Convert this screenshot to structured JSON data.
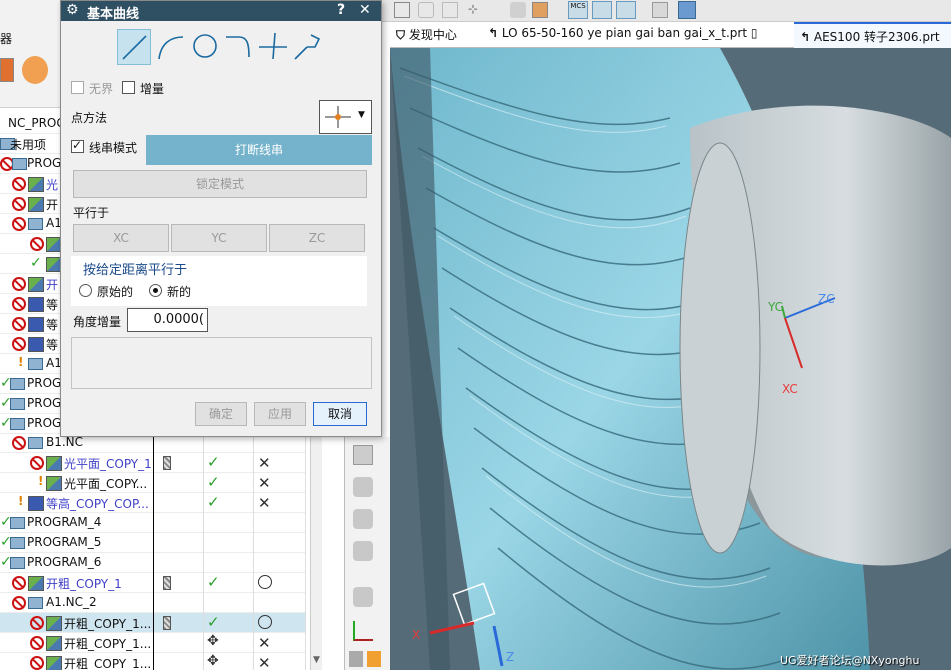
{
  "dialog": {
    "title": "基本曲线",
    "help_glyph": "?",
    "close_glyph": "✕",
    "unbounded_label": "无界",
    "incremental_label": "增量",
    "point_method_label": "点方法",
    "string_mode_label": "线串模式",
    "break_string_label": "打断线串",
    "lock_mode_label": "锁定模式",
    "parallel_to_label": "平行于",
    "xc_label": "XC",
    "yc_label": "YC",
    "zc_label": "ZC",
    "parallel_distance_label": "按给定距离平行于",
    "original_label": "原始的",
    "new_label": "新的",
    "angle_increment_label": "角度增量",
    "angle_increment_value": "0.0000(",
    "ok_label": "确定",
    "apply_label": "应用",
    "cancel_label": "取消"
  },
  "nav": {
    "partial_label": "器",
    "rows": [
      {
        "label": "NC_PROG"
      },
      {
        "label": "未用项"
      },
      {
        "label": "PROG"
      },
      {
        "label": "光"
      },
      {
        "label": "开"
      },
      {
        "label": "A1"
      },
      {
        "label": "开"
      },
      {
        "label": "等"
      },
      {
        "label": "等"
      },
      {
        "label": "等"
      },
      {
        "label": "A1"
      },
      {
        "label": "PROG"
      },
      {
        "label": "PROG"
      },
      {
        "label": "PROG"
      },
      {
        "label": "B1.NC"
      },
      {
        "label": "光平面_COPY_1"
      },
      {
        "label": "光平面_COPY..."
      },
      {
        "label": "等高_COPY_COP..."
      },
      {
        "label": "PROGRAM_4"
      },
      {
        "label": "PROGRAM_5"
      },
      {
        "label": "PROGRAM_6"
      },
      {
        "label": "开粗_COPY_1"
      },
      {
        "label": "A1.NC_2"
      },
      {
        "label": "开粗_COPY_1..."
      },
      {
        "label": "开粗_COPY_1..."
      },
      {
        "label": "开粗_COPY_1..."
      }
    ]
  },
  "tabs": [
    {
      "label": "发现中心"
    },
    {
      "label": "LO 65-50-160 ye pian  gai ban  gai_x_t.prt"
    },
    {
      "label": "AES100 转子2306.prt"
    }
  ],
  "viewport": {
    "axis_yc": "YC",
    "axis_zc": "ZC",
    "axis_xc": "XC",
    "triad_x": "X",
    "triad_z": "Z",
    "watermark": "UG爱好者论坛@NXyonghu"
  }
}
